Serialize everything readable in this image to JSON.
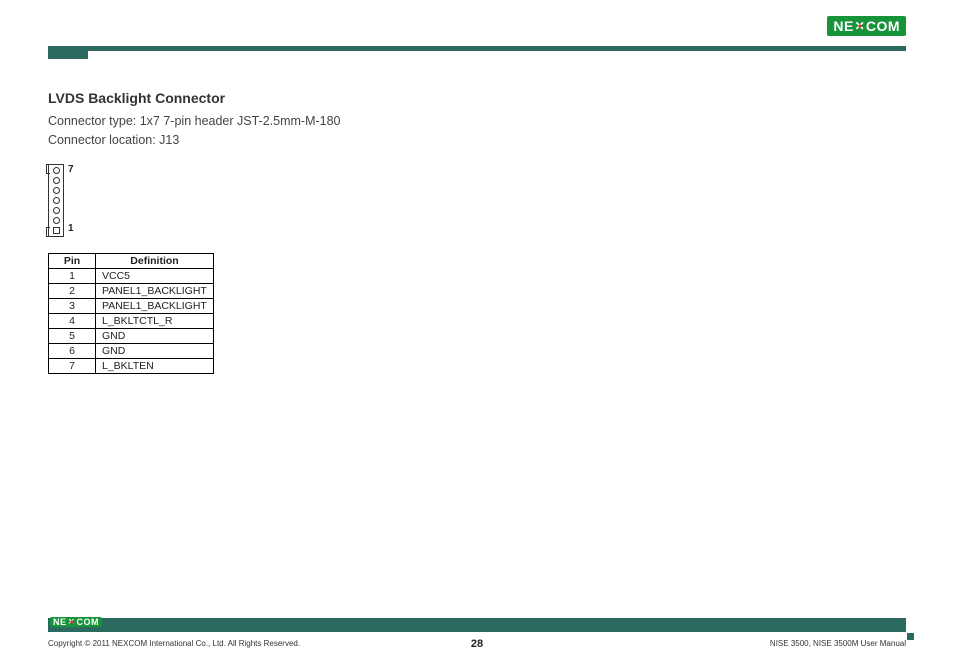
{
  "brand": {
    "name_left": "NE",
    "name_right": "COM"
  },
  "section": {
    "title": "LVDS Backlight Connector",
    "connector_type_line": "Connector type: 1x7 7-pin header JST-2.5mm-M-180",
    "connector_location_line": "Connector location: J13"
  },
  "diagram": {
    "top_label": "7",
    "bottom_label": "1"
  },
  "table": {
    "headers": {
      "pin": "Pin",
      "definition": "Definition"
    },
    "rows": [
      {
        "pin": "1",
        "definition": "VCC5"
      },
      {
        "pin": "2",
        "definition": "PANEL1_BACKLIGHT"
      },
      {
        "pin": "3",
        "definition": "PANEL1_BACKLIGHT"
      },
      {
        "pin": "4",
        "definition": "L_BKLTCTL_R"
      },
      {
        "pin": "5",
        "definition": "GND"
      },
      {
        "pin": "6",
        "definition": "GND"
      },
      {
        "pin": "7",
        "definition": "L_BKLTEN"
      }
    ]
  },
  "footer": {
    "copyright": "Copyright © 2011 NEXCOM International Co., Ltd. All Rights Reserved.",
    "page_number": "28",
    "manual": "NISE 3500, NISE 3500M User Manual"
  }
}
